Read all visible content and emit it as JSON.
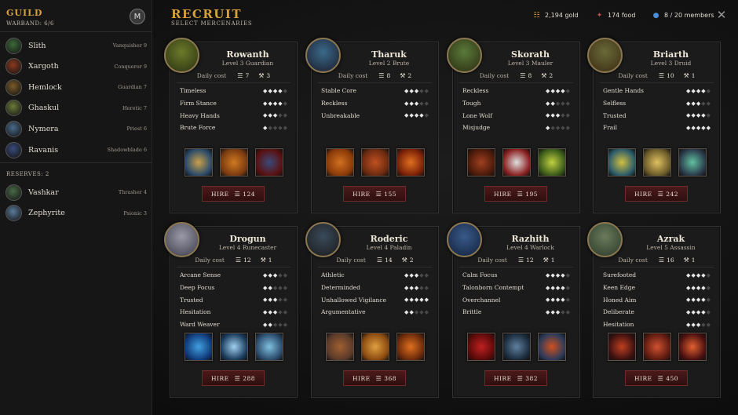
{
  "guild": {
    "title": "GUILD",
    "warband": "WARBAND: 6/6",
    "emblem_letter": "M",
    "members": [
      {
        "name": "Slith",
        "role": "Vanquisher 9",
        "color": "#3c6a3a"
      },
      {
        "name": "Xargoth",
        "role": "Conqueror 9",
        "color": "#8a3a20"
      },
      {
        "name": "Hemlock",
        "role": "Guardian 7",
        "color": "#7a5a2a"
      },
      {
        "name": "Ghaskul",
        "role": "Heretic 7",
        "color": "#6a7a3a"
      },
      {
        "name": "Nymera",
        "role": "Priest 6",
        "color": "#4a6a8a"
      },
      {
        "name": "Ravanis",
        "role": "Shadowblade 6",
        "color": "#3a4a7a"
      }
    ],
    "reserves_label": "RESERVES: 2",
    "reserves": [
      {
        "name": "Vashkar",
        "role": "Thrasher 4",
        "color": "#4a6a4a"
      },
      {
        "name": "Zephyrite",
        "role": "Psionic 3",
        "color": "#5a7a9a"
      }
    ]
  },
  "header": {
    "title": "RECRUIT",
    "subtitle": "SELECT MERCENARIES",
    "gold": "2,194 gold",
    "food": "174 food",
    "members": "8 / 20 members",
    "gold_icon": "coin-stack-icon",
    "food_icon": "meat-icon",
    "members_icon": "person-icon"
  },
  "labels": {
    "daily_cost": "Daily cost",
    "hire": "HIRE"
  },
  "colors": {
    "accent": "#d8a13a",
    "hire_bg": "#3a1414",
    "gem_full": "#e6e6e6",
    "gem_empty": "#4a4a4a"
  },
  "cards": [
    {
      "name": "Rowanth",
      "class": "Level 3 Guardian",
      "food": "7",
      "upkeep": "3",
      "price": "124",
      "portrait": [
        "#6b7a2a",
        "#2a3010"
      ],
      "traits": [
        {
          "name": "Timeless",
          "gems": 4
        },
        {
          "name": "Firm Stance",
          "gems": 4
        },
        {
          "name": "Heavy Hands",
          "gems": 3
        },
        {
          "name": "Brute Force",
          "gems": 1
        }
      ],
      "skills": [
        [
          "#2a4a6a",
          "#c9a04a"
        ],
        [
          "#7a3a10",
          "#d07a20"
        ],
        [
          "#5a1010",
          "#3a4a7a"
        ]
      ]
    },
    {
      "name": "Tharuk",
      "class": "Level 2 Brute",
      "food": "8",
      "upkeep": "2",
      "price": "155",
      "portrait": [
        "#3a6a8a",
        "#1a1a2a"
      ],
      "traits": [
        {
          "name": "Stable Core",
          "gems": 3
        },
        {
          "name": "Reckless",
          "gems": 3
        },
        {
          "name": "Unbreakable",
          "gems": 4
        }
      ],
      "skills": [
        [
          "#8a3a08",
          "#d07020"
        ],
        [
          "#6a2a10",
          "#c05020"
        ],
        [
          "#7a2008",
          "#e07020"
        ]
      ]
    },
    {
      "name": "Skorath",
      "class": "Level 3 Mauler",
      "food": "8",
      "upkeep": "2",
      "price": "195",
      "portrait": [
        "#5a7a3a",
        "#2a2a10"
      ],
      "traits": [
        {
          "name": "Reckless",
          "gems": 4
        },
        {
          "name": "Tough",
          "gems": 2
        },
        {
          "name": "Lone Wolf",
          "gems": 3
        },
        {
          "name": "Misjudge",
          "gems": 1
        }
      ],
      "skills": [
        [
          "#4a1a0a",
          "#a04020"
        ],
        [
          "#8a2020",
          "#e0e0e0"
        ],
        [
          "#3a5a1a",
          "#c0d040"
        ]
      ]
    },
    {
      "name": "Briarth",
      "class": "Level 3 Druid",
      "food": "10",
      "upkeep": "1",
      "price": "242",
      "portrait": [
        "#6a6a3a",
        "#3a2a10"
      ],
      "traits": [
        {
          "name": "Gentle Hands",
          "gems": 4
        },
        {
          "name": "Selfless",
          "gems": 3
        },
        {
          "name": "Trusted",
          "gems": 4
        },
        {
          "name": "Frail",
          "gems": 5
        }
      ],
      "skills": [
        [
          "#2a5a6a",
          "#d0c040"
        ],
        [
          "#6a5a2a",
          "#e0c060"
        ],
        [
          "#2a3a4a",
          "#60c0a0"
        ]
      ]
    },
    {
      "name": "Drogun",
      "class": "Level 4 Runecaster",
      "food": "12",
      "upkeep": "1",
      "price": "288",
      "portrait": [
        "#9a9aa8",
        "#3a3a4a"
      ],
      "traits": [
        {
          "name": "Arcane Sense",
          "gems": 3
        },
        {
          "name": "Deep Focus",
          "gems": 2
        },
        {
          "name": "Trusted",
          "gems": 3
        },
        {
          "name": "Hesitation",
          "gems": 3
        },
        {
          "name": "Ward Weaver",
          "gems": 2
        }
      ],
      "skills": [
        [
          "#103a7a",
          "#40a0e0"
        ],
        [
          "#1a3a5a",
          "#a0d0f0"
        ],
        [
          "#2a4a6a",
          "#80c0e0"
        ]
      ]
    },
    {
      "name": "Roderic",
      "class": "Level 4 Paladin",
      "food": "14",
      "upkeep": "2",
      "price": "368",
      "portrait": [
        "#3a4a5a",
        "#1a1a1a"
      ],
      "traits": [
        {
          "name": "Athletic",
          "gems": 3
        },
        {
          "name": "Determinded",
          "gems": 3
        },
        {
          "name": "Unhallowed Vigilance",
          "gems": 5
        },
        {
          "name": "Argumentative",
          "gems": 2
        }
      ],
      "skills": [
        [
          "#5a3a2a",
          "#a06030"
        ],
        [
          "#8a4a10",
          "#e0a040"
        ],
        [
          "#6a2a0a",
          "#e07020"
        ]
      ]
    },
    {
      "name": "Razhith",
      "class": "Level 4 Warlock",
      "food": "12",
      "upkeep": "1",
      "price": "382",
      "portrait": [
        "#3a5a8a",
        "#10203a"
      ],
      "traits": [
        {
          "name": "Calm Focus",
          "gems": 4
        },
        {
          "name": "Talonborn Contempt",
          "gems": 4
        },
        {
          "name": "Overchannel",
          "gems": 4
        },
        {
          "name": "Brittle",
          "gems": 3
        }
      ],
      "skills": [
        [
          "#5a0a0a",
          "#c02020"
        ],
        [
          "#1a2a3a",
          "#6080a0"
        ],
        [
          "#2a3a5a",
          "#d05020"
        ]
      ]
    },
    {
      "name": "Azrak",
      "class": "Level 5 Assassin",
      "food": "16",
      "upkeep": "1",
      "price": "450",
      "portrait": [
        "#6a7a5a",
        "#2a3a2a"
      ],
      "traits": [
        {
          "name": "Surefooted",
          "gems": 4
        },
        {
          "name": "Keen Edge",
          "gems": 4
        },
        {
          "name": "Honed Aim",
          "gems": 4
        },
        {
          "name": "Deliberate",
          "gems": 4
        },
        {
          "name": "Hesitation",
          "gems": 3
        }
      ],
      "skills": [
        [
          "#3a1010",
          "#c04020"
        ],
        [
          "#5a1a10",
          "#d05030"
        ],
        [
          "#4a1010",
          "#e06030"
        ]
      ]
    }
  ]
}
